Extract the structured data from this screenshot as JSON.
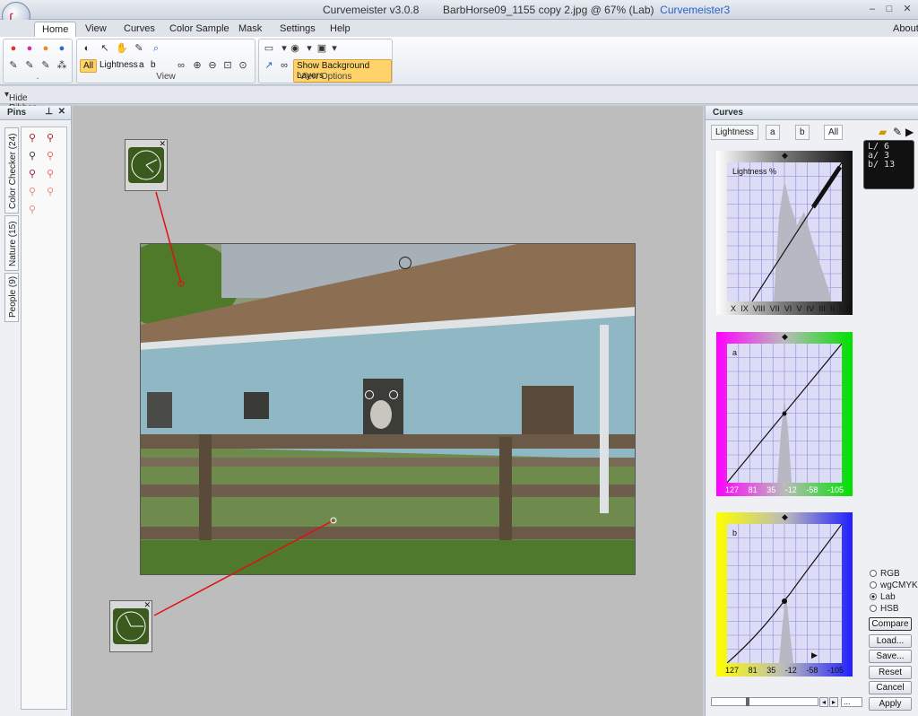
{
  "window": {
    "app": "Curvemeister v3.0.8",
    "document": "BarbHorse09_1155 copy 2.jpg @ 67% (Lab)",
    "product": "Curvemeister3",
    "about": "About"
  },
  "tabs": [
    "Home",
    "View",
    "Curves",
    "Color Sample",
    "Mask",
    "Settings",
    "Help"
  ],
  "ribbon": {
    "group1_label": ".",
    "view_channels": {
      "all": "All",
      "lightness": "Lightness",
      "a": "a",
      "b": "b"
    },
    "view_label": "View",
    "view_options_label": "View Options",
    "show_bg": "Show Background Layers"
  },
  "hide_ribbon": "Hide Ribbon",
  "pins": {
    "title": "Pins",
    "tabs": [
      "Color Checker (24)",
      "Nature (15)",
      "People (9)"
    ]
  },
  "curves": {
    "title": "Curves",
    "tabs": [
      "Lightness",
      "a",
      "b",
      "All"
    ],
    "lightness_label": "Lightness %",
    "lightness_ticks": [
      "X",
      "IX",
      "VIII",
      "VII",
      "VI",
      "V",
      "IV",
      "III",
      "II",
      "I",
      "0"
    ],
    "a_label": "a",
    "b_label": "b",
    "ab_ticks": [
      "127",
      "81",
      "35",
      "-12",
      "-58",
      "-105"
    ],
    "readout": {
      "l": "L/ 6",
      "a": "a/ 3",
      "b": "b/ 13"
    },
    "modes": [
      "RGB",
      "wgCMYK",
      "Lab",
      "HSB"
    ],
    "selected_mode": "Lab",
    "buttons": [
      "Compare",
      "Load...",
      "Save...",
      "Reset",
      "Cancel",
      "Apply"
    ],
    "zoom_value": "..."
  },
  "colors": {
    "accent": "#2a5fc9",
    "pin_line": "#e01010",
    "grid": "#8a88d8",
    "clock_face": "#3b5a1e"
  }
}
